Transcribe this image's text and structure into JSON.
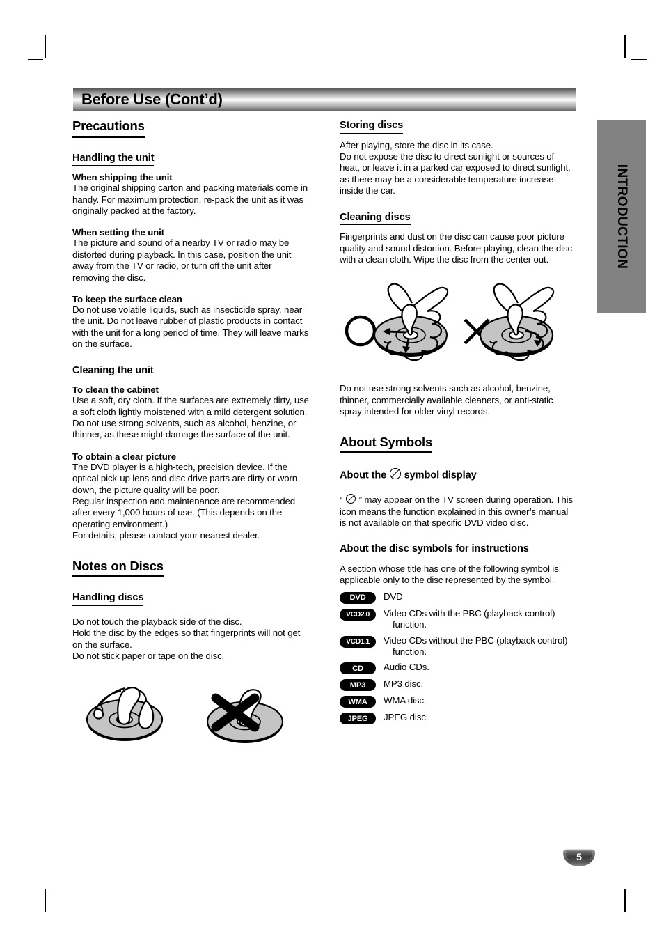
{
  "header": {
    "title": "Before Use (Cont’d)"
  },
  "side_tab": {
    "label": "INTRODUCTION"
  },
  "page_number": "5",
  "left_column": {
    "section_title": "Precautions",
    "subsection_1": {
      "heading": "Handling the unit",
      "blocks": [
        {
          "lead": "When shipping the unit",
          "text": "The original shipping carton and packing materials come in handy. For maximum protection, re-pack the unit as it was originally packed at the factory."
        },
        {
          "lead": "When setting the unit",
          "text": "The picture and sound of a nearby TV or radio may be distorted during playback. In this case, position the unit away from the TV or radio, or turn off the unit after removing the disc."
        },
        {
          "lead": "To keep the surface clean",
          "text": "Do not use volatile liquids, such as insecticide spray, near the unit. Do not leave rubber of plastic products in contact with the unit for a long period of time. They will leave marks on the surface."
        }
      ]
    },
    "subsection_2": {
      "heading": "Cleaning the unit",
      "blocks": [
        {
          "lead": "To clean the cabinet",
          "text": "Use a soft, dry cloth. If the surfaces are extremely dirty, use a soft cloth lightly moistened with a mild detergent solution. Do not use strong solvents, such as alcohol, benzine, or thinner, as these might damage the surface of the unit."
        },
        {
          "lead": "To obtain a clear picture",
          "text": "The DVD player is a high-tech, precision device. If the optical pick-up lens and disc drive parts are dirty or worn down, the picture quality will be poor.\nRegular inspection and maintenance are recommended after every 1,000 hours of use. (This depends on the operating environment.)\nFor details, please contact your nearest dealer."
        }
      ]
    },
    "section_title_2": "Notes on Discs",
    "subsection_3": {
      "heading": "Handling discs",
      "text": "Do not touch the playback side of the disc.\nHold the disc by the edges so that fingerprints will not get on the surface.\nDo not stick paper or tape on the disc."
    },
    "figure_handling_discs": {
      "name": "disc-handling-illustration",
      "correct_caption": "hand holding disc by edges",
      "incorrect_caption": "crossed-out hand touching disc surface"
    }
  },
  "right_column": {
    "subsection_storing": {
      "heading": "Storing discs",
      "text": "After playing, store the disc in its case.\nDo not expose the disc to direct sunlight or sources of heat, or leave it in a parked car exposed to direct sunlight, as there may be a considerable temperature increase inside the car."
    },
    "subsection_cleaning": {
      "heading": "Cleaning discs",
      "text": "Fingerprints and dust on the disc can cause poor picture quality and sound distortion. Before playing, clean the disc with a clean cloth. Wipe the disc from the center out."
    },
    "figure_cleaning_discs": {
      "name": "disc-cleaning-illustration",
      "correct_marker": "circle",
      "incorrect_marker": "cross"
    },
    "solvent_warning": "Do not use strong solvents such as alcohol, benzine, thinner, commercially available cleaners, or anti-static spray intended for older vinyl records.",
    "section_title": "About Symbols",
    "subsection_symbol_display": {
      "heading_before": "About the",
      "heading_after": "symbol display",
      "text_before": "“",
      "text_after": "” may appear on the TV screen during operation. This icon means the function explained in this owner’s manual is not available on that specific DVD video disc."
    },
    "subsection_disc_symbols": {
      "heading": "About the disc symbols for instructions",
      "intro": "A section whose title has one of the following symbol is applicable only to the disc represented by the symbol.",
      "items": [
        {
          "badge": "DVD",
          "description": "DVD",
          "continuation": ""
        },
        {
          "badge": "VCD2.0",
          "description": "Video CDs with the PBC (playback control)",
          "continuation": "function."
        },
        {
          "badge": "VCD1.1",
          "description": "Video CDs without the PBC (playback control)",
          "continuation": "function."
        },
        {
          "badge": "CD",
          "description": "Audio CDs.",
          "continuation": ""
        },
        {
          "badge": "MP3",
          "description": "MP3 disc.",
          "continuation": ""
        },
        {
          "badge": "WMA",
          "description": "WMA disc.",
          "continuation": ""
        },
        {
          "badge": "JPEG",
          "description": "JPEG disc.",
          "continuation": ""
        }
      ]
    }
  },
  "colors": {
    "side_tab_gray": "#828282",
    "disc_fill_gray": "#c4c4c4",
    "text_black": "#000000"
  }
}
